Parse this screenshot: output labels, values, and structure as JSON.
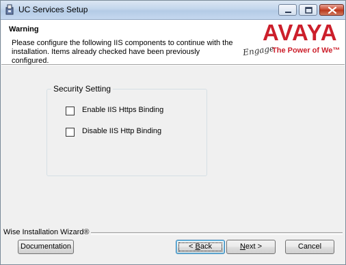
{
  "window": {
    "title": "UC Services Setup",
    "controls": [
      "minimize-icon",
      "maximize-icon",
      "close-icon"
    ]
  },
  "banner": {
    "title": "Warning",
    "description": "Please configure the following IIS components to continue with the installation. Items already checked have been previously configured.",
    "logo": {
      "word": "AVAYA",
      "engage": "Engage",
      "tagline": "The Power of We™",
      "color": "#cc1f2b"
    }
  },
  "group": {
    "label": "Security Setting",
    "options": [
      {
        "label": "Enable IIS Https Binding",
        "checked": false
      },
      {
        "label": "Disable IIS Http Binding",
        "checked": false
      }
    ]
  },
  "footer": {
    "wizard_label": "Wise Installation Wizard®",
    "documentation": "Documentation",
    "back_mnemonic": "B",
    "back_rest": "ack",
    "back_prefix": "< ",
    "next_mnemonic": "N",
    "next_rest": "ext >",
    "cancel": "Cancel"
  }
}
